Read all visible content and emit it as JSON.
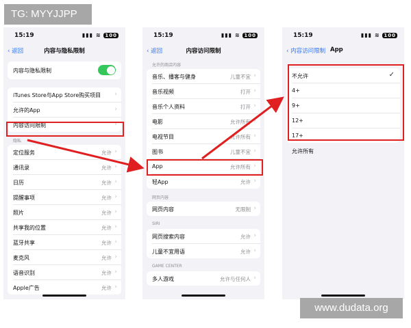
{
  "watermark_top": "TG: MYYJJPP",
  "watermark_bottom": "www.dudata.org",
  "status_bar": {
    "time": "15:19",
    "signal": "▮▮▮ ≋",
    "battery": "100"
  },
  "screen1": {
    "back": "返回",
    "title": "内容与隐私限制",
    "toggle_row": {
      "label": "内容与隐私限制",
      "on": true
    },
    "group2": [
      {
        "label": "iTunes Store与App Store购买项目"
      },
      {
        "label": "允许的App"
      },
      {
        "label": "内容访问限制"
      }
    ],
    "privacy_header": "隐私",
    "privacy_rows": [
      {
        "label": "定位服务",
        "value": "允许"
      },
      {
        "label": "通讯录",
        "value": "允许"
      },
      {
        "label": "日历",
        "value": "允许"
      },
      {
        "label": "提醒事项",
        "value": "允许"
      },
      {
        "label": "照片",
        "value": "允许"
      },
      {
        "label": "共享我的位置",
        "value": "允许"
      },
      {
        "label": "蓝牙共享",
        "value": "允许"
      },
      {
        "label": "麦克风",
        "value": "允许"
      },
      {
        "label": "语音识别",
        "value": "允许"
      },
      {
        "label": "Apple广告",
        "value": "允许"
      }
    ]
  },
  "screen2": {
    "back": "返回",
    "title": "内容访问限制",
    "store_header": "允许的商店内容",
    "store_rows": [
      {
        "label": "音乐、播客与健身",
        "value": "儿童不宜"
      },
      {
        "label": "音乐视频",
        "value": "打开"
      },
      {
        "label": "音乐个人资料",
        "value": "打开"
      },
      {
        "label": "电影",
        "value": "允许所有"
      },
      {
        "label": "电视节目",
        "value": "允许所有"
      },
      {
        "label": "图书",
        "value": "儿童不宜"
      },
      {
        "label": "App",
        "value": "允许所有"
      },
      {
        "label": "轻App",
        "value": "允许"
      }
    ],
    "web_header": "网页内容",
    "web_rows": [
      {
        "label": "网页内容",
        "value": "无限制"
      }
    ],
    "siri_header": "SIRI",
    "siri_rows": [
      {
        "label": "网页搜索内容",
        "value": "允许"
      },
      {
        "label": "儿童不宜用语",
        "value": "允许"
      }
    ],
    "gc_header": "GAME CENTER",
    "gc_rows": [
      {
        "label": "多人游戏",
        "value": "允许与任何人"
      }
    ]
  },
  "screen3": {
    "back": "内容访问限制",
    "title": "App",
    "options": [
      {
        "label": "不允许",
        "checked": true
      },
      {
        "label": "4+",
        "checked": false
      },
      {
        "label": "9+",
        "checked": false
      },
      {
        "label": "12+",
        "checked": false
      },
      {
        "label": "17+",
        "checked": false
      }
    ],
    "allow_all": "允许所有"
  },
  "icons": {
    "chevron": "›",
    "check": "✓",
    "back_chevron": "‹"
  },
  "colors": {
    "accent": "#3478f6",
    "highlight": "#e02020",
    "toggle_on": "#34c759"
  }
}
